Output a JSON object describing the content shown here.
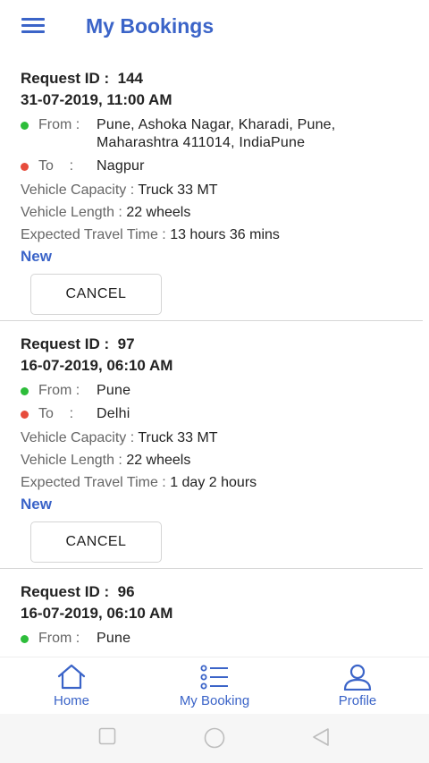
{
  "header": {
    "title": "My Bookings",
    "menu_icon": "hamburger-menu-icon"
  },
  "colors": {
    "accent": "#3b64c8",
    "from_dot": "#2dbd3a",
    "to_dot": "#e74c3c"
  },
  "labels": {
    "request_id": "Request ID :  ",
    "from": "From :",
    "to": "To    :",
    "vehicle_capacity": "Vehicle Capacity : ",
    "vehicle_length": "Vehicle Length : ",
    "expected_travel_time": "Expected Travel Time : ",
    "cancel": "CANCEL"
  },
  "bookings": [
    {
      "id": "144",
      "datetime": "31-07-2019, 11:00 AM",
      "from": "Pune, Ashoka Nagar, Kharadi, Pune, Maharashtra 411014, IndiaPune",
      "to": "Nagpur",
      "vehicle_capacity": "Truck 33 MT",
      "vehicle_length": "22 wheels",
      "expected_travel_time": "13 hours 36 mins",
      "status": "New"
    },
    {
      "id": "97",
      "datetime": "16-07-2019, 06:10 AM",
      "from": "Pune",
      "to": "Delhi",
      "vehicle_capacity": "Truck 33 MT",
      "vehicle_length": "22 wheels",
      "expected_travel_time": "1 day 2 hours",
      "status": "New"
    },
    {
      "id": "96",
      "datetime": "16-07-2019, 06:10 AM",
      "from": "Pune"
    }
  ],
  "bottom_nav": [
    {
      "label": "Home",
      "icon": "home-icon"
    },
    {
      "label": "My Booking",
      "icon": "list-icon"
    },
    {
      "label": "Profile",
      "icon": "user-icon"
    }
  ],
  "system_nav": [
    "recents-square-icon",
    "home-circle-icon",
    "back-triangle-icon"
  ]
}
